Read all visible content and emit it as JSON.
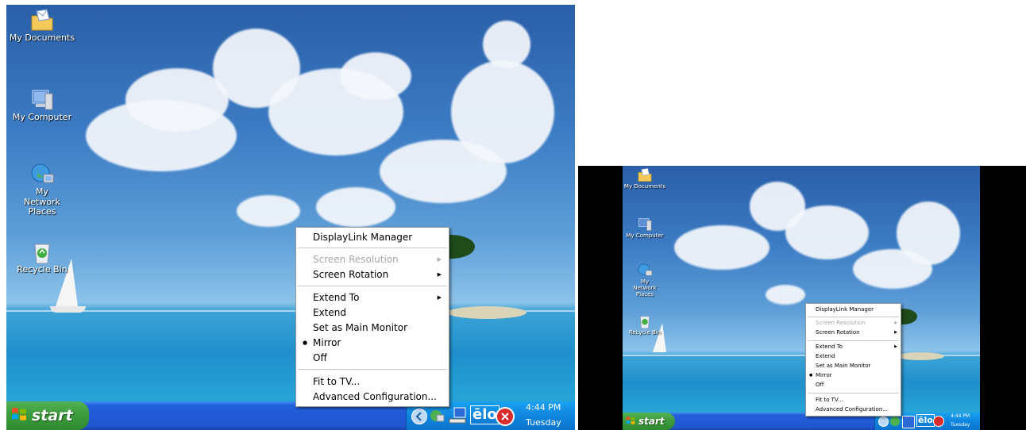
{
  "desktop_icons": [
    {
      "name": "my-documents",
      "label": "My Documents"
    },
    {
      "name": "my-computer",
      "label": "My Computer"
    },
    {
      "name": "my-network-places",
      "label": "My Network Places"
    },
    {
      "name": "recycle-bin",
      "label": "Recycle Bin"
    }
  ],
  "taskbar": {
    "start_label": "start",
    "time": "4:44 PM",
    "day": "Tuesday",
    "tray_logo": "ēlo"
  },
  "context_menu": {
    "items": {
      "displaylink_manager": "DisplayLink Manager",
      "screen_resolution": "Screen Resolution",
      "screen_rotation": "Screen Rotation",
      "extend_to": "Extend To",
      "extend": "Extend",
      "set_as_main_monitor": "Set as Main Monitor",
      "mirror": "Mirror",
      "off": "Off",
      "fit_to_tv": "Fit to TV...",
      "advanced_configuration": "Advanced Configuration..."
    },
    "checked_item": "mirror",
    "submenu_arrow": "▶",
    "bullet": "●"
  },
  "icons": [
    "folder-envelope-icon",
    "computer-icon",
    "network-globe-icon",
    "recycle-bin-icon",
    "windows-flag-icon",
    "tray-arrow-icon",
    "network-tray-icon",
    "display-tray-icon",
    "security-shield-icon"
  ]
}
